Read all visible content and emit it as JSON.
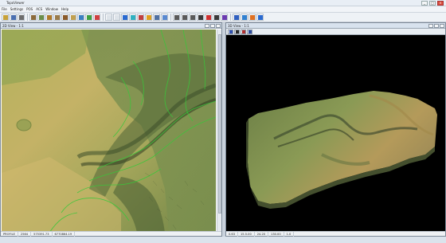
{
  "app": {
    "title": "TopoViewer",
    "window_buttons": [
      "_",
      "□",
      "×"
    ]
  },
  "menu": {
    "items": [
      "File",
      "Settings",
      "POS",
      "ACS",
      "Window",
      "Help"
    ]
  },
  "toolbar": {
    "buttons": [
      {
        "icon": "open-folder-icon",
        "color": "#c8a23a"
      },
      {
        "icon": "save-icon",
        "color": "#4a6fb0"
      },
      {
        "icon": "print-icon",
        "color": "#6c6c6c"
      },
      {
        "icon": "hillshade-icon",
        "color": "#8b6a3a"
      },
      {
        "icon": "terrain-icon",
        "color": "#6a8e4a"
      },
      {
        "icon": "contour-icon",
        "color": "#b07a2a"
      },
      {
        "icon": "slope-icon",
        "color": "#9a7b4a"
      },
      {
        "icon": "aspect-icon",
        "color": "#8a5a2a"
      },
      {
        "icon": "layer-icon",
        "color": "#c0a050"
      },
      {
        "icon": "grid-icon",
        "color": "#3a7fc0"
      },
      {
        "icon": "palette-icon",
        "color": "#40a040"
      },
      {
        "icon": "color-ramp-icon",
        "color": "#d04040"
      },
      {
        "icon": "blank-icon",
        "color": "#dde3e9"
      },
      {
        "icon": "blank-icon",
        "color": "#dde3e9"
      },
      {
        "icon": "blue-square-icon",
        "color": "#2a6ad0"
      },
      {
        "icon": "cyan-square-icon",
        "color": "#30b0c0"
      },
      {
        "icon": "chart-icon",
        "color": "#c04040"
      },
      {
        "icon": "rgb-icon",
        "color": "#e0a020"
      },
      {
        "icon": "table-icon",
        "color": "#5070a0"
      },
      {
        "icon": "window-icon",
        "color": "#5a8ad0"
      },
      {
        "icon": "zoom-in-icon",
        "color": "#5a5a5a"
      },
      {
        "icon": "zoom-out-icon",
        "color": "#5a5a5a"
      },
      {
        "icon": "pan-icon",
        "color": "#5a5a5a"
      },
      {
        "icon": "pointer-icon",
        "color": "#3a3a3a"
      },
      {
        "icon": "marker-icon",
        "color": "#d03030"
      },
      {
        "icon": "query-icon",
        "color": "#3a3a3a"
      },
      {
        "icon": "measure-icon",
        "color": "#6a3ab0"
      },
      {
        "icon": "pencil-icon",
        "color": "#3060c0"
      },
      {
        "icon": "globe-icon",
        "color": "#3080d0"
      },
      {
        "icon": "settings-icon",
        "color": "#e07020"
      },
      {
        "icon": "help-icon",
        "color": "#2a6ad0"
      }
    ]
  },
  "left_window": {
    "title": "2D View - 1:1",
    "status": [
      "PROFILE",
      "2564",
      "575391.73",
      "6770864.19"
    ]
  },
  "right_window": {
    "title": "3D View - 1:1",
    "toolbar": [
      {
        "icon": "home-icon",
        "color": "#3050b0"
      },
      {
        "icon": "camera-icon",
        "color": "#2a2a2a"
      },
      {
        "icon": "rotate-icon",
        "color": "#b03030"
      },
      {
        "icon": "light-icon",
        "color": "#2a4aa0"
      }
    ],
    "status": [
      "0.63",
      "15.5.00",
      "24.20",
      "130.00",
      "1.0"
    ]
  },
  "colors": {
    "terrain_low": "#c9b56a",
    "terrain_mid": "#8fa058",
    "terrain_high": "#5f7a40",
    "contour": "#38c83a",
    "background_3d": "#000000"
  }
}
